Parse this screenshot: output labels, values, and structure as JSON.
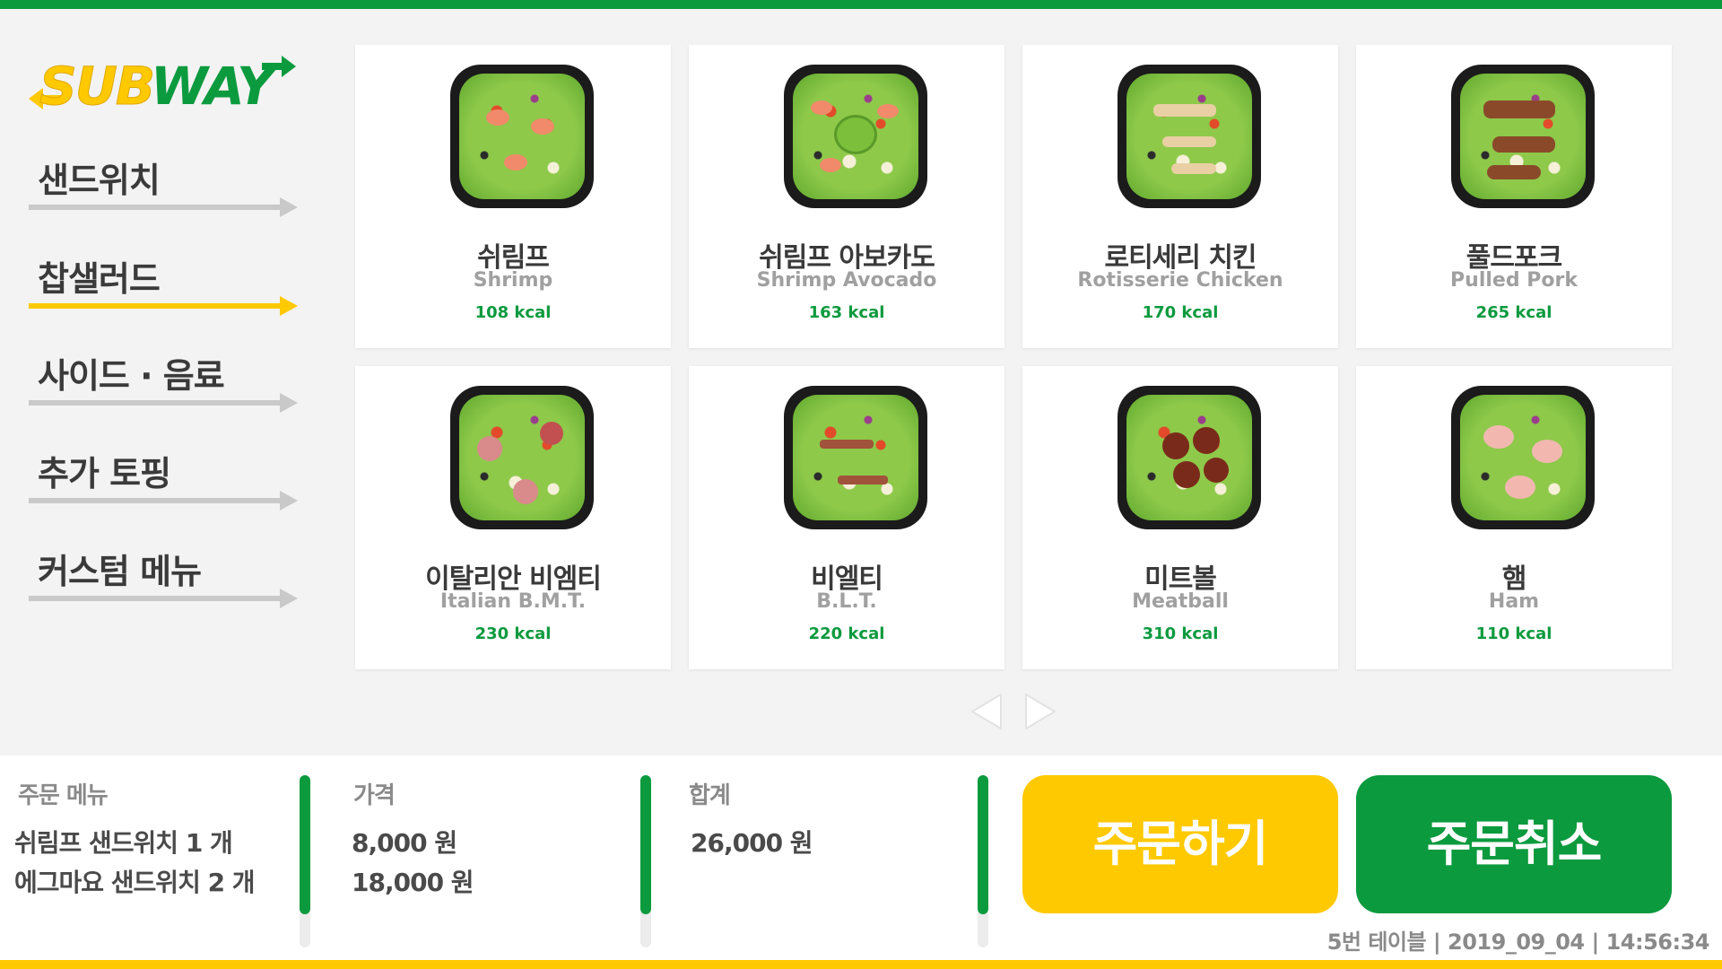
{
  "brand": {
    "logo_sub": "SUB",
    "logo_way": "WAY",
    "colors": {
      "green": "#0c9a3e",
      "yellow": "#ffc900"
    }
  },
  "sidebar": {
    "items": [
      {
        "label": "샌드위치",
        "active": false
      },
      {
        "label": "찹샐러드",
        "active": true
      },
      {
        "label": "사이드 · 음료",
        "active": false
      },
      {
        "label": "추가 토핑",
        "active": false
      },
      {
        "label": "커스텀 메뉴",
        "active": false
      }
    ]
  },
  "menu": {
    "items": [
      {
        "name_ko": "쉬림프",
        "name_en": "Shrimp",
        "kcal": "108 kcal"
      },
      {
        "name_ko": "쉬림프 아보카도",
        "name_en": "Shrimp Avocado",
        "kcal": "163 kcal"
      },
      {
        "name_ko": "로티세리 치킨",
        "name_en": "Rotisserie Chicken",
        "kcal": "170 kcal"
      },
      {
        "name_ko": "풀드포크",
        "name_en": "Pulled Pork",
        "kcal": "265 kcal"
      },
      {
        "name_ko": "이탈리안 비엠티",
        "name_en": "Italian B.M.T.",
        "kcal": "230 kcal"
      },
      {
        "name_ko": "비엘티",
        "name_en": "B.L.T.",
        "kcal": "220 kcal"
      },
      {
        "name_ko": "미트볼",
        "name_en": "Meatball",
        "kcal": "310 kcal"
      },
      {
        "name_ko": "햄",
        "name_en": "Ham",
        "kcal": "110 kcal"
      }
    ]
  },
  "order": {
    "menu_title": "주문 메뉴",
    "menu_lines": [
      "쉬림프 샌드위치 1 개",
      "에그마요 샌드위치 2 개"
    ],
    "price_title": "가격",
    "price_lines": [
      "8,000 원",
      "18,000 원"
    ],
    "total_title": "합계",
    "total_value": "26,000 원",
    "order_button": "주문하기",
    "cancel_button": "주문취소",
    "status": "5번 테이블 | 2019_09_04 | 14:56:34"
  }
}
